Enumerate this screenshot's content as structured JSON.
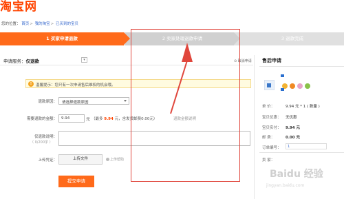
{
  "logo": {
    "text": "淘宝网"
  },
  "breadcrumb": {
    "prefix": "您的位置：",
    "items": [
      "首页",
      "我的淘宝",
      "已买到的宝贝"
    ]
  },
  "steps": [
    {
      "label": "1 买家申请退款",
      "state": "active"
    },
    {
      "label": "2 卖家处理退款申请",
      "state": "pending"
    },
    {
      "label": "3 退款完成",
      "state": "pending"
    }
  ],
  "service": {
    "prefix": "申请服务：",
    "value": "仅退款",
    "cancel_label": "⊙ 取消申请"
  },
  "notice": {
    "icon": "!",
    "text": "温馨提示：您只有一次申请售后维权的机会哦。"
  },
  "form": {
    "reason_label": "退款原因：",
    "reason_placeholder": "请选择退款原因",
    "amount_label": "需要退款的金额：",
    "amount_value": "9.94",
    "amount_unit": "元",
    "amount_note_prefix": "（最多",
    "amount_max": "9.94",
    "amount_note_suffix": "元，含发货邮费0.00元）",
    "amount_link": "退款金额说明",
    "desc_label": "仅退款说明：",
    "desc_counter": "（ 0/200字 ）",
    "upload_label": "上传凭证：",
    "upload_button": "上传文件",
    "upload_help": "上传帮助",
    "submit": "提交申请"
  },
  "sidebar": {
    "title": "售后申请",
    "rows": [
      {
        "label": "单   价：",
        "value": "9.94 元 * 1 ( 数量 )"
      },
      {
        "label": "宝贝优惠：",
        "value": "无优惠"
      },
      {
        "label": "宝贝实付：",
        "value": "9.94 元"
      },
      {
        "label": "邮   费：",
        "value": "0.00 元"
      },
      {
        "label": "订单编号：",
        "value": "1"
      }
    ],
    "footer_label": "卖   家："
  },
  "watermark": {
    "text": "Baidu 经验",
    "sub": "jingyan.baidu.com"
  },
  "colors": {
    "brand_orange": "#ff6a1a",
    "logo_red": "#ff4400",
    "highlight_box": "#e0463c",
    "link_blue": "#3366cc"
  }
}
